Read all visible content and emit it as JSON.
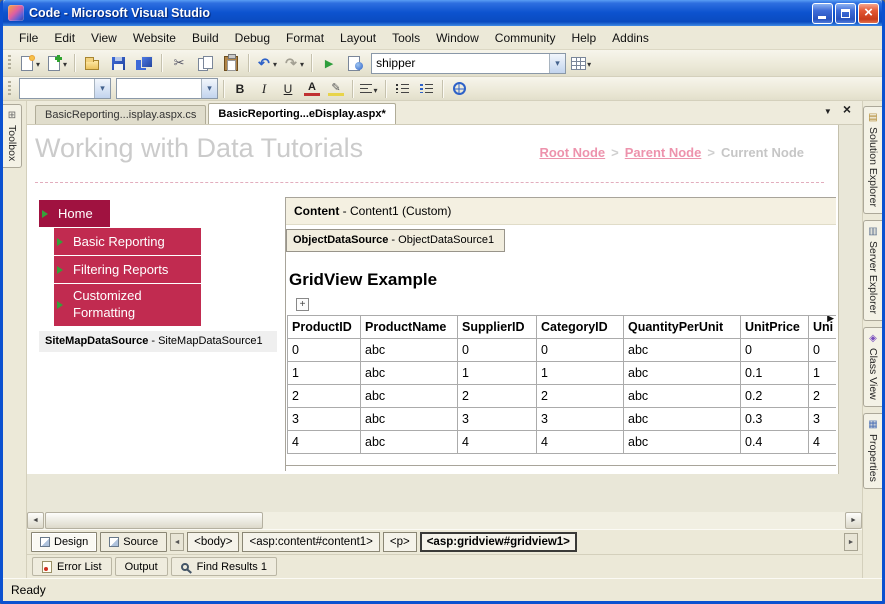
{
  "window": {
    "title": "Code - Microsoft Visual Studio",
    "status": "Ready"
  },
  "menubar": {
    "items": [
      "File",
      "Edit",
      "View",
      "Website",
      "Build",
      "Debug",
      "Format",
      "Layout",
      "Tools",
      "Window",
      "Community",
      "Help",
      "Addins"
    ]
  },
  "toolbar": {
    "datasource_value": "shipper"
  },
  "doc_tabs": {
    "inactive": "BasicReporting...isplay.aspx.cs",
    "active": "BasicReporting...eDisplay.aspx*"
  },
  "side_tabs": {
    "left": "Toolbox",
    "right": [
      "Solution Explorer",
      "Server Explorer",
      "Class View",
      "Properties"
    ]
  },
  "design": {
    "page_title": "Working with Data Tutorials",
    "breadcrumb": {
      "root": "Root Node",
      "separator": ">",
      "parent": "Parent Node",
      "current": "Current Node"
    },
    "nav": {
      "home": "Home",
      "items": [
        "Basic Reporting",
        "Filtering Reports",
        "Customized Formatting"
      ]
    },
    "sitemap_datasource": {
      "name": "SiteMapDataSource",
      "suffix": " - SiteMapDataSource1"
    },
    "content_header": {
      "name": "Content",
      "suffix": " - Content1 (Custom)"
    },
    "object_datasource": {
      "name": "ObjectDataSource",
      "suffix": " - ObjectDataSource1"
    },
    "gridview": {
      "title": "GridView Example",
      "columns": [
        "ProductID",
        "ProductName",
        "SupplierID",
        "CategoryID",
        "QuantityPerUnit",
        "UnitPrice",
        "Uni"
      ],
      "rows": [
        [
          "0",
          "abc",
          "0",
          "0",
          "abc",
          "0",
          "0"
        ],
        [
          "1",
          "abc",
          "1",
          "1",
          "abc",
          "0.1",
          "1"
        ],
        [
          "2",
          "abc",
          "2",
          "2",
          "abc",
          "0.2",
          "2"
        ],
        [
          "3",
          "abc",
          "3",
          "3",
          "abc",
          "0.3",
          "3"
        ],
        [
          "4",
          "abc",
          "4",
          "4",
          "abc",
          "0.4",
          "4"
        ]
      ]
    }
  },
  "viewbar": {
    "design": "Design",
    "source": "Source",
    "tags": [
      "<body>",
      "<asp:content#content1>",
      "<p>",
      "<asp:gridview#gridview1>"
    ]
  },
  "panel_tabs": [
    "Error List",
    "Output",
    "Find Results 1"
  ],
  "colors": {
    "titlebar_blue": "#0B51D0",
    "chrome_beige": "#ECE9D8",
    "nav_home_red": "#A01240",
    "nav_item_red": "#C12B50",
    "nav_marker_green": "#35A03A",
    "breadcrumb_link_pink": "#ED92AC",
    "page_title_gray": "#CBCBCB"
  },
  "icons": {
    "titlebar": [
      "app-icon",
      "minimize-icon",
      "maximize-icon",
      "close-icon"
    ],
    "standard_toolbar": [
      "new-project-icon",
      "add-new-item-icon",
      "open-file-icon",
      "save-icon",
      "save-all-icon",
      "cut-icon",
      "copy-icon",
      "paste-icon",
      "undo-icon",
      "redo-icon",
      "start-debug-icon",
      "view-in-browser-icon",
      "table-icon",
      "dropdown-arrow-icon"
    ],
    "formatting_toolbar": [
      "bold-icon",
      "italic-icon",
      "underline-icon",
      "font-color-icon",
      "highlight-icon",
      "align-icon",
      "bullet-list-icon",
      "numbered-list-icon",
      "hyperlink-icon"
    ],
    "tab_strip": [
      "active-files-dropdown-icon",
      "close-document-icon"
    ],
    "side_tabs": [
      "toolbox-icon",
      "solution-explorer-icon",
      "server-explorer-icon",
      "class-view-icon",
      "properties-icon"
    ],
    "design_surface": [
      "move-handle-icon",
      "smart-tag-arrow-icon"
    ],
    "panel_tabs": [
      "error-list-icon",
      "find-results-icon"
    ]
  }
}
